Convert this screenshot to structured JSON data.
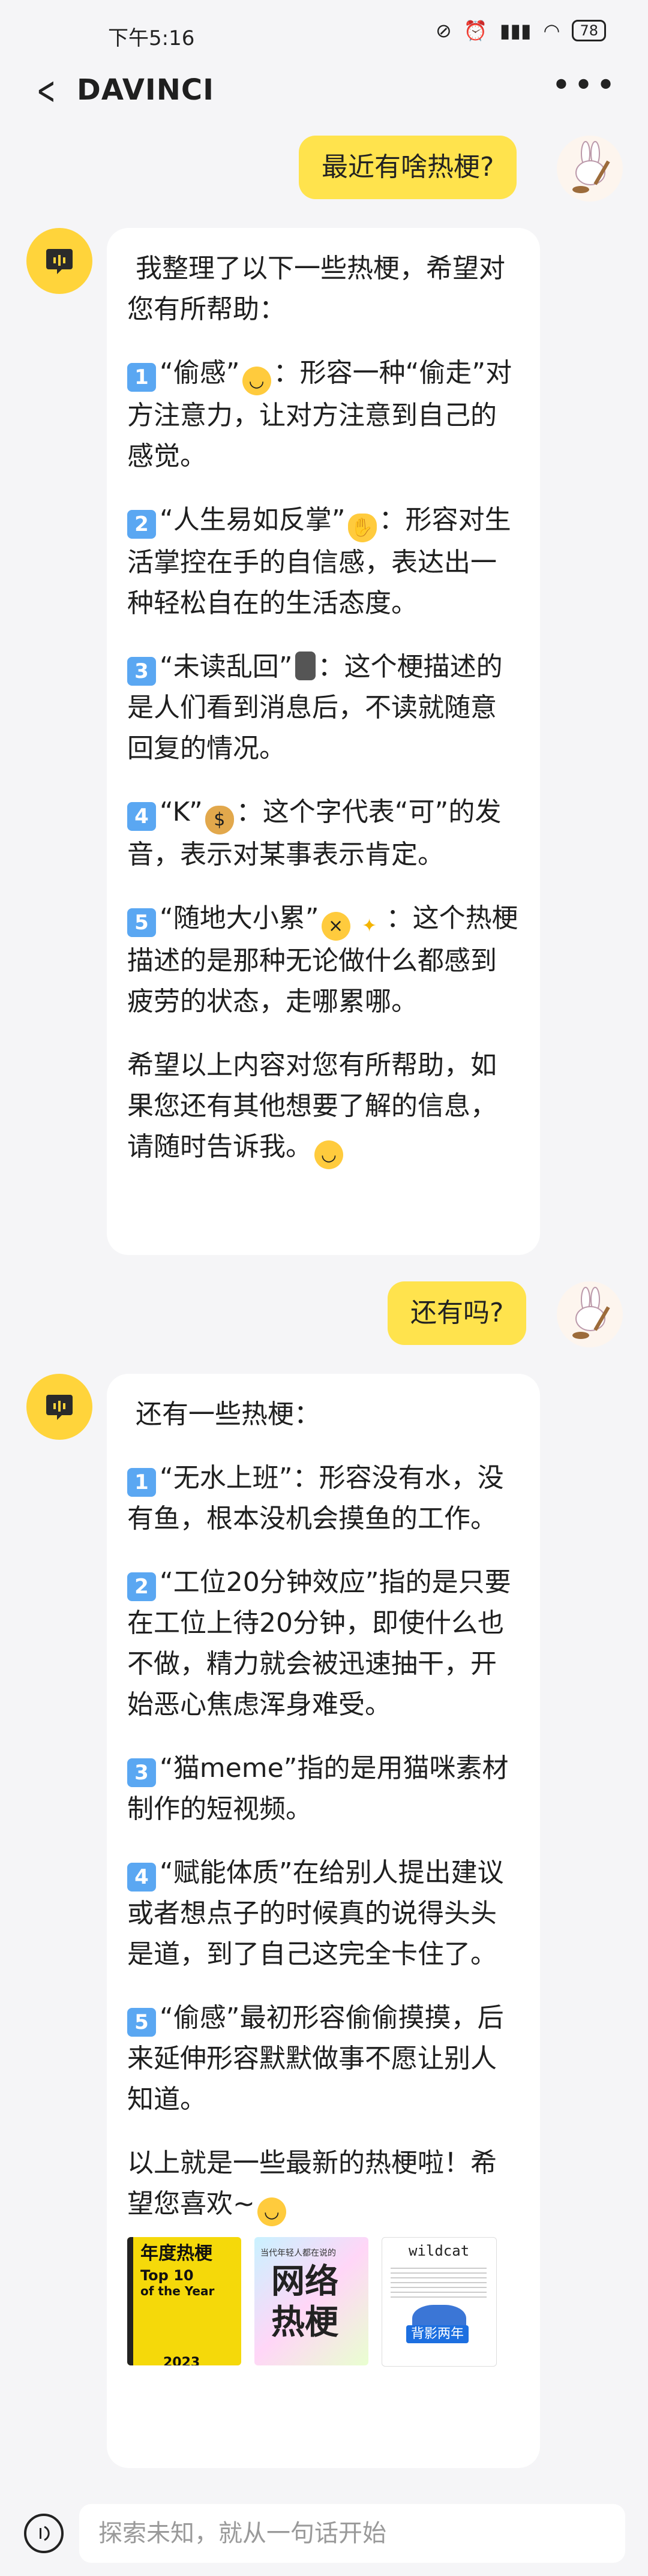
{
  "status_bar": {
    "time": "下午5:16",
    "battery": "78"
  },
  "header": {
    "title": "DAVINCI"
  },
  "messages": [
    {
      "role": "user",
      "text": "最近有啥热梗?"
    },
    {
      "role": "bot",
      "intro": "我整理了以下一些热梗，希望对您有所帮助：",
      "items": [
        {
          "num": "1",
          "text_a": "“偷感”",
          "text_b": "：形容一种“偷走”对方注意力，让对方注意到自己的感觉。"
        },
        {
          "num": "2",
          "text_a": "“人生易如反掌”",
          "text_b": "：形容对生活掌控在手的自信感，表达出一种轻松自在的生活态度。"
        },
        {
          "num": "3",
          "text_a": "“未读乱回”",
          "text_b": "：这个梗描述的是人们看到消息后，不读就随意回复的情况。"
        },
        {
          "num": "4",
          "text_a": "“K”",
          "text_b": "：这个字代表“可”的发音，表示对某事表示肯定。"
        },
        {
          "num": "5",
          "text_a": "“随地大小累”",
          "text_b": "：这个热梗描述的是那种无论做什么都感到疲劳的状态，走哪累哪。"
        }
      ],
      "outro": "希望以上内容对您有所帮助，如果您还有其他想要了解的信息，请随时告诉我。"
    },
    {
      "role": "user",
      "text": "还有吗?"
    },
    {
      "role": "bot",
      "intro": "还有一些热梗：",
      "items": [
        {
          "num": "1",
          "text": "“无水上班”：形容没有水，没有鱼，根本没机会摸鱼的工作。"
        },
        {
          "num": "2",
          "text": "“工位20分钟效应”指的是只要在工位上待20分钟，即使什么也不做，精力就会被迅速抽干，开始恶心焦虑浑身难受。"
        },
        {
          "num": "3",
          "text": "“猫meme”指的是用猫咪素材制作的短视频。"
        },
        {
          "num": "4",
          "text": "“赋能体质”在给别人提出建议或者想点子的时候真的说得头头是道，到了自己这完全卡住了。"
        },
        {
          "num": "5",
          "text": "“偷感”最初形容偷偷摸摸，后来延伸形容默默做事不愿让别人知道。"
        }
      ],
      "outro": "以上就是一些最新的热梗啦！希望您喜欢~",
      "images": [
        {
          "line1": "年度热梗",
          "line2": "Top 10",
          "line3": "of the Year",
          "line4": "2023"
        },
        {
          "line1": "当代年轻人都在说的",
          "line2": "网络",
          "line3": "热梗"
        },
        {
          "line1": "wildcat",
          "line2": "背影两年"
        }
      ]
    }
  ],
  "input": {
    "placeholder": "探索未知，就从一句话开始"
  }
}
